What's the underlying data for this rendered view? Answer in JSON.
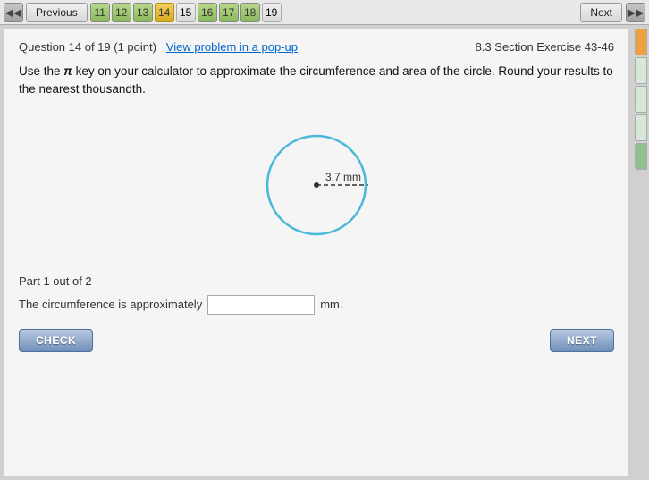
{
  "nav": {
    "prev_label": "Previous",
    "next_label": "Next",
    "numbers": [
      {
        "n": "11",
        "state": "green"
      },
      {
        "n": "12",
        "state": "green"
      },
      {
        "n": "13",
        "state": "green"
      },
      {
        "n": "14",
        "state": "active"
      },
      {
        "n": "15",
        "state": "plain"
      },
      {
        "n": "16",
        "state": "green"
      },
      {
        "n": "17",
        "state": "green"
      },
      {
        "n": "18",
        "state": "green"
      },
      {
        "n": "19",
        "state": "plain"
      }
    ]
  },
  "question": {
    "meta": "Question 14 of 19 (1 point)",
    "link_label": "View problem in a pop-up",
    "section_ref": "8.3 Section Exercise 43-46",
    "text_before_pi": "Use the ",
    "pi_symbol": "π",
    "text_after_pi": " key on your calculator to approximate the circumference and area of the circle. Round your results to the nearest thousandth.",
    "radius_label": "3.7 mm",
    "part_info": "Part 1 out of 2",
    "answer_label": "The circumference is approximately",
    "answer_unit": "mm.",
    "answer_placeholder": "",
    "check_label": "CHECK",
    "next_label": "NEXT"
  }
}
